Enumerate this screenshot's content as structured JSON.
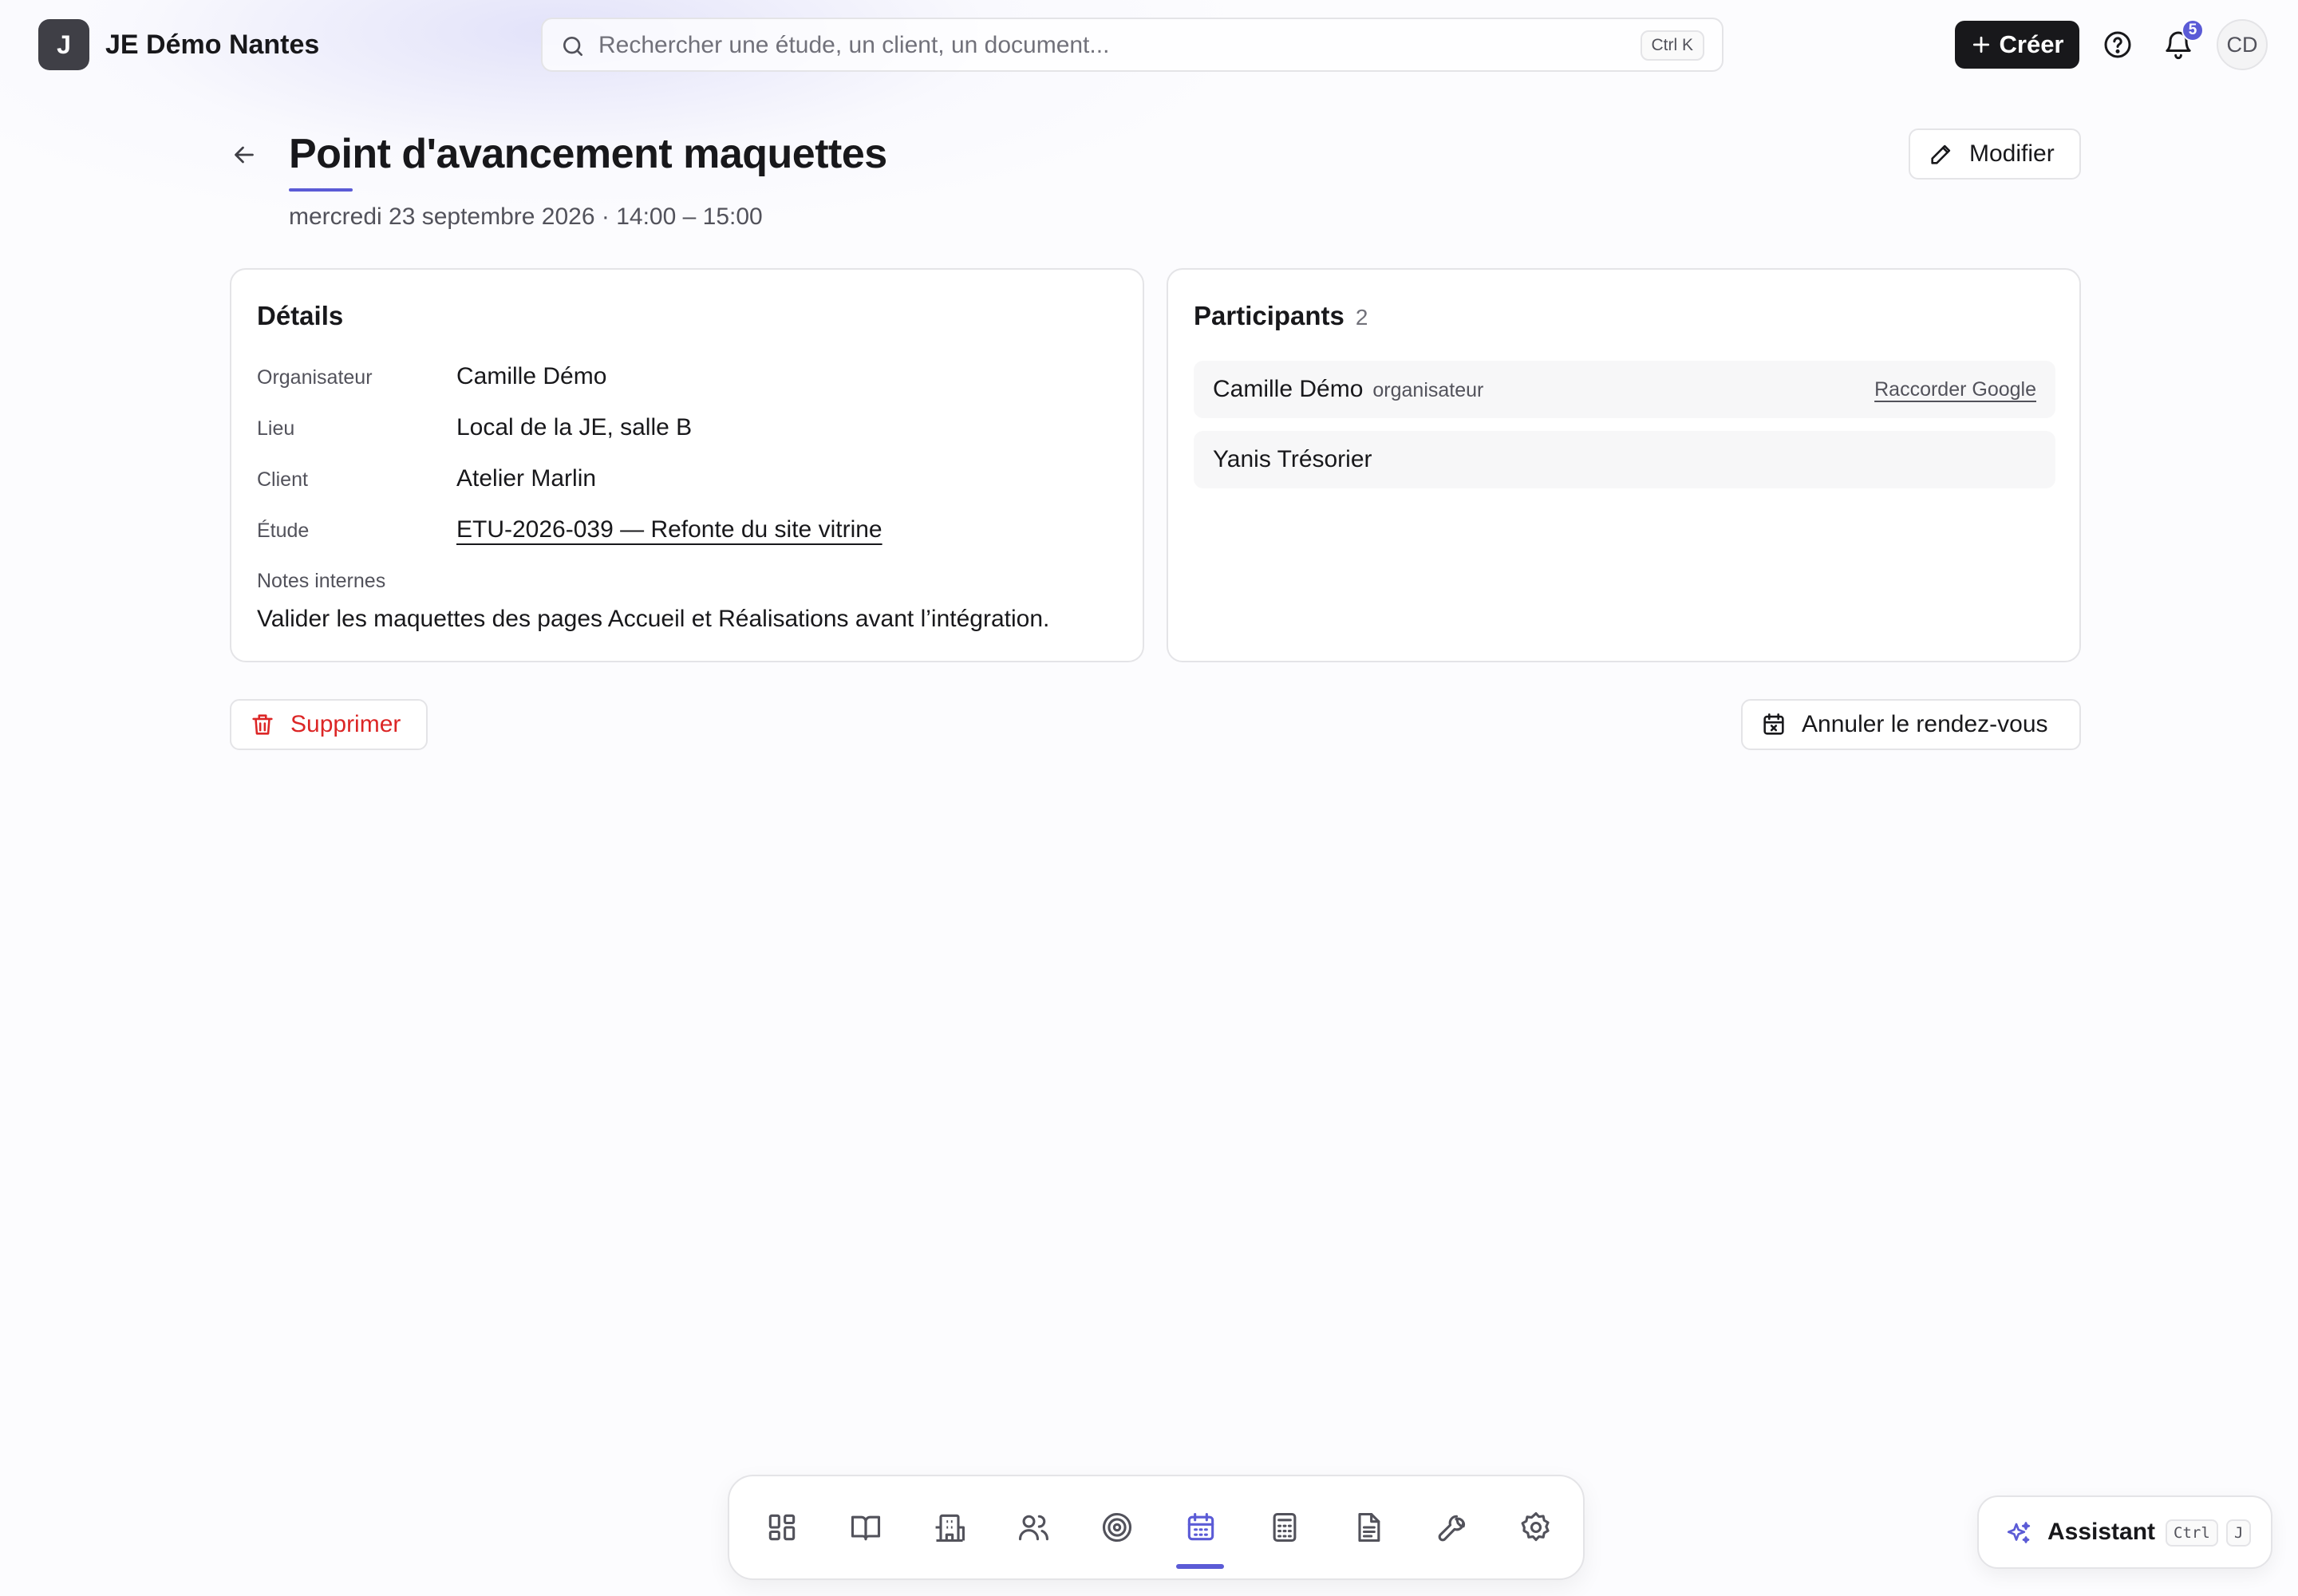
{
  "app": {
    "badge": "J",
    "name": "JE Démo Nantes"
  },
  "search": {
    "placeholder": "Rechercher une étude, un client, un document...",
    "shortcut": "Ctrl K"
  },
  "topbar": {
    "create_label": "Créer",
    "notifications_count": "5",
    "avatar_initials": "CD"
  },
  "event": {
    "title": "Point d'avancement maquettes",
    "subtitle": "mercredi 23 septembre 2026 · 14:00 – 15:00",
    "edit_label": "Modifier"
  },
  "details": {
    "title": "Détails",
    "rows": [
      {
        "label": "Organisateur",
        "value": "Camille Démo"
      },
      {
        "label": "Lieu",
        "value": "Local de la JE, salle B"
      },
      {
        "label": "Client",
        "value": "Atelier Marlin"
      },
      {
        "label": "Étude",
        "value": "ETU-2026-039 — Refonte du site vitrine"
      }
    ],
    "notes_label": "Notes internes",
    "notes": "Valider les maquettes des pages Accueil et Réalisations avant l’intégration."
  },
  "participants": {
    "title": "Participants",
    "count": "2",
    "items": [
      {
        "name": "Camille Démo",
        "role": "organisateur",
        "action": "Raccorder Google"
      },
      {
        "name": "Yanis Trésorier"
      }
    ]
  },
  "actions": {
    "delete_label": "Supprimer",
    "cancel_label": "Annuler le rendez-vous"
  },
  "dock": {
    "items": [
      "dashboard-icon",
      "book-icon",
      "building-icon",
      "users-icon",
      "target-icon",
      "calendar-icon",
      "calculator-icon",
      "document-icon",
      "wrench-icon",
      "settings-icon"
    ],
    "active": "calendar-icon"
  },
  "assistant": {
    "label": "Assistant",
    "key1": "Ctrl",
    "key2": "J"
  },
  "colors": {
    "accent": "#5b5bd6",
    "danger": "#dc2626",
    "primary_button": "#18181b"
  }
}
